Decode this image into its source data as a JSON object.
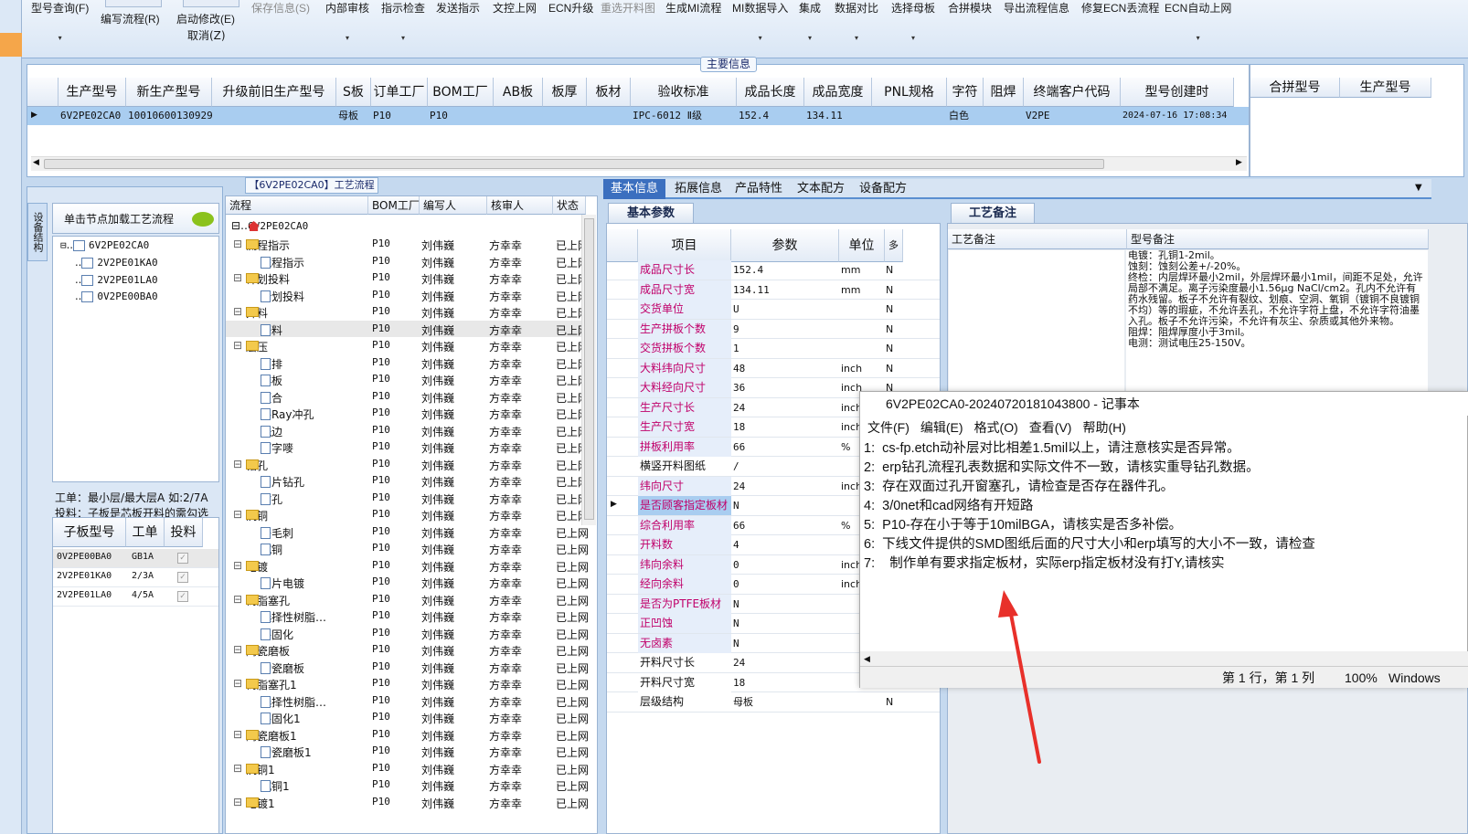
{
  "toolbar": {
    "items": [
      {
        "label": "型号查询(F)",
        "disabled": false
      },
      {
        "label": "编写流程(R)",
        "disabled": false
      },
      {
        "label": "启动修改(E)",
        "disabled": false
      },
      {
        "label": "保存信息(S)",
        "disabled": true
      },
      {
        "label": "内部审核",
        "disabled": false
      },
      {
        "label": "指示检查",
        "disabled": false
      },
      {
        "label": "发送指示",
        "disabled": false
      },
      {
        "label": "文控上网",
        "disabled": false
      },
      {
        "label": "ECN升级",
        "disabled": false
      },
      {
        "label": "重选开料图",
        "disabled": true
      },
      {
        "label": "生成MI流程",
        "disabled": false
      },
      {
        "label": "MI数据导入",
        "disabled": false
      },
      {
        "label": "集成",
        "disabled": false
      },
      {
        "label": "数据对比",
        "disabled": false
      },
      {
        "label": "选择母板",
        "disabled": false
      },
      {
        "label": "合拼模块",
        "disabled": false
      },
      {
        "label": "导出流程信息",
        "disabled": false
      },
      {
        "label": "修复ECN丢流程",
        "disabled": false
      },
      {
        "label": "ECN自动上网",
        "disabled": false
      }
    ],
    "cancel_label": "取消(Z)"
  },
  "main_info": {
    "title": "主要信息",
    "columns": [
      "生产型号",
      "新生产型号",
      "升级前旧生产型号",
      "S板",
      "订单工厂",
      "BOM工厂",
      "AB板",
      "板厚",
      "板材",
      "验收标准",
      "成品长度",
      "成品宽度",
      "PNL规格",
      "字符",
      "阻焊",
      "终端客户代码",
      "型号创建时"
    ],
    "row": [
      "6V2PE02CA0",
      "10010600130929",
      "",
      "母板",
      "P10",
      "P10",
      "",
      "",
      "",
      "IPC-6012 Ⅱ级",
      "152.4",
      "134.11",
      "",
      "白色",
      "",
      "V2PE",
      "2024-07-16 17:08:34"
    ],
    "merge_columns": [
      "合拼型号",
      "生产型号"
    ]
  },
  "left_panel": {
    "vertical_tab": "设备结构",
    "node_header": "单击节点加载工艺流程",
    "tree_root": "6V2PE02CA0",
    "tree_children": [
      "2V2PE01KA0",
      "2V2PE01LA0",
      "0V2PE00BA0"
    ],
    "work_note_1": "工单：最小层/最大层A 如:2/7A",
    "work_note_2": "投料：子板是芯板开料的需勾选",
    "sub_columns": [
      "子板型号",
      "工单",
      "投料"
    ],
    "sub_rows": [
      {
        "model": "0V2PE00BA0",
        "order": "GB1A"
      },
      {
        "model": "2V2PE01KA0",
        "order": "2/3A"
      },
      {
        "model": "2V2PE01LA0",
        "order": "4/5A"
      }
    ]
  },
  "process": {
    "title": "【6V2PE02CA0】工艺流程",
    "columns": [
      "流程",
      "BOM工厂",
      "编写人",
      "核审人",
      "状态"
    ],
    "root": "6V2PE02CA0",
    "rows": [
      {
        "name": "流程指示",
        "type": "folder",
        "bom": "P10",
        "writer": "刘伟巍",
        "reviewer": "方幸幸",
        "status": "已上网"
      },
      {
        "name": "流程指示",
        "type": "doc",
        "bom": "P10",
        "writer": "刘伟巍",
        "reviewer": "方幸幸",
        "status": "已上网"
      },
      {
        "name": "计划投料",
        "type": "folder",
        "bom": "P10",
        "writer": "刘伟巍",
        "reviewer": "方幸幸",
        "status": "已上网"
      },
      {
        "name": "计划投料",
        "type": "doc",
        "bom": "P10",
        "writer": "刘伟巍",
        "reviewer": "方幸幸",
        "status": "已上网"
      },
      {
        "name": "开料",
        "type": "folder",
        "bom": "P10",
        "writer": "刘伟巍",
        "reviewer": "方幸幸",
        "status": "已上网"
      },
      {
        "name": "开料",
        "type": "doc",
        "bom": "P10",
        "writer": "刘伟巍",
        "reviewer": "方幸幸",
        "status": "已上网",
        "selected": true
      },
      {
        "name": "层压",
        "type": "folder",
        "bom": "P10",
        "writer": "刘伟巍",
        "reviewer": "方幸幸",
        "status": "已上网"
      },
      {
        "name": "预排",
        "type": "doc",
        "bom": "P10",
        "writer": "刘伟巍",
        "reviewer": "方幸幸",
        "status": "已上网"
      },
      {
        "name": "排板",
        "type": "doc",
        "bom": "P10",
        "writer": "刘伟巍",
        "reviewer": "方幸幸",
        "status": "已上网"
      },
      {
        "name": "压合",
        "type": "doc",
        "bom": "P10",
        "writer": "刘伟巍",
        "reviewer": "方幸幸",
        "status": "已上网"
      },
      {
        "name": "X-Ray冲孔",
        "type": "doc",
        "bom": "P10",
        "writer": "刘伟巍",
        "reviewer": "方幸幸",
        "status": "已上网"
      },
      {
        "name": "铣边",
        "type": "doc",
        "bom": "P10",
        "writer": "刘伟巍",
        "reviewer": "方幸幸",
        "status": "已上网"
      },
      {
        "name": "打字嘜",
        "type": "doc",
        "bom": "P10",
        "writer": "刘伟巍",
        "reviewer": "方幸幸",
        "status": "已上网"
      },
      {
        "name": "钻孔",
        "type": "folder",
        "bom": "P10",
        "writer": "刘伟巍",
        "reviewer": "方幸幸",
        "status": "已上网"
      },
      {
        "name": "铝片钻孔",
        "type": "doc",
        "bom": "P10",
        "writer": "刘伟巍",
        "reviewer": "方幸幸",
        "status": "已上网"
      },
      {
        "name": "钻孔",
        "type": "doc",
        "bom": "P10",
        "writer": "刘伟巍",
        "reviewer": "方幸幸",
        "status": "已上网"
      },
      {
        "name": "沉铜",
        "type": "folder",
        "bom": "P10",
        "writer": "刘伟巍",
        "reviewer": "方幸幸",
        "status": "已上网"
      },
      {
        "name": "去毛刺",
        "type": "doc",
        "bom": "P10",
        "writer": "刘伟巍",
        "reviewer": "方幸幸",
        "status": "已上网"
      },
      {
        "name": "沉铜",
        "type": "doc",
        "bom": "P10",
        "writer": "刘伟巍",
        "reviewer": "方幸幸",
        "status": "已上网"
      },
      {
        "name": "电镀",
        "type": "folder",
        "bom": "P10",
        "writer": "刘伟巍",
        "reviewer": "方幸幸",
        "status": "已上网"
      },
      {
        "name": "负片电镀",
        "type": "doc",
        "bom": "P10",
        "writer": "刘伟巍",
        "reviewer": "方幸幸",
        "status": "已上网"
      },
      {
        "name": "树脂塞孔",
        "type": "folder",
        "bom": "P10",
        "writer": "刘伟巍",
        "reviewer": "方幸幸",
        "status": "已上网"
      },
      {
        "name": "选择性树脂…",
        "type": "doc",
        "bom": "P10",
        "writer": "刘伟巍",
        "reviewer": "方幸幸",
        "status": "已上网"
      },
      {
        "name": "终固化",
        "type": "doc",
        "bom": "P10",
        "writer": "刘伟巍",
        "reviewer": "方幸幸",
        "status": "已上网"
      },
      {
        "name": "陶瓷磨板",
        "type": "folder",
        "bom": "P10",
        "writer": "刘伟巍",
        "reviewer": "方幸幸",
        "status": "已上网"
      },
      {
        "name": "陶瓷磨板",
        "type": "doc",
        "bom": "P10",
        "writer": "刘伟巍",
        "reviewer": "方幸幸",
        "status": "已上网"
      },
      {
        "name": "树脂塞孔1",
        "type": "folder",
        "bom": "P10",
        "writer": "刘伟巍",
        "reviewer": "方幸幸",
        "status": "已上网"
      },
      {
        "name": "选择性树脂…",
        "type": "doc",
        "bom": "P10",
        "writer": "刘伟巍",
        "reviewer": "方幸幸",
        "status": "已上网"
      },
      {
        "name": "终固化1",
        "type": "doc",
        "bom": "P10",
        "writer": "刘伟巍",
        "reviewer": "方幸幸",
        "status": "已上网"
      },
      {
        "name": "陶瓷磨板1",
        "type": "folder",
        "bom": "P10",
        "writer": "刘伟巍",
        "reviewer": "方幸幸",
        "status": "已上网"
      },
      {
        "name": "陶瓷磨板1",
        "type": "doc",
        "bom": "P10",
        "writer": "刘伟巍",
        "reviewer": "方幸幸",
        "status": "已上网"
      },
      {
        "name": "沉铜1",
        "type": "folder",
        "bom": "P10",
        "writer": "刘伟巍",
        "reviewer": "方幸幸",
        "status": "已上网"
      },
      {
        "name": "沉铜1",
        "type": "doc",
        "bom": "P10",
        "writer": "刘伟巍",
        "reviewer": "方幸幸",
        "status": "已上网"
      },
      {
        "name": "电镀1",
        "type": "folder",
        "bom": "P10",
        "writer": "刘伟巍",
        "reviewer": "方幸幸",
        "status": "已上网"
      }
    ]
  },
  "tabs": {
    "items": [
      "基本信息",
      "拓展信息",
      "产品特性",
      "文本配方",
      "设备配方"
    ],
    "active": 0
  },
  "basic_params": {
    "title": "基本参数",
    "columns": [
      "项目",
      "参数",
      "单位",
      "多"
    ],
    "rows": [
      {
        "name": "成品尺寸长",
        "value": "152.4",
        "unit": "mm",
        "flag": "N",
        "pink": true
      },
      {
        "name": "成品尺寸宽",
        "value": "134.11",
        "unit": "mm",
        "flag": "N",
        "pink": true
      },
      {
        "name": "交货单位",
        "value": "U",
        "unit": "",
        "flag": "N",
        "pink": true
      },
      {
        "name": "生产拼板个数",
        "value": "9",
        "unit": "",
        "flag": "N",
        "pink": true
      },
      {
        "name": "交货拼板个数",
        "value": "1",
        "unit": "",
        "flag": "N",
        "pink": true
      },
      {
        "name": "大料纬向尺寸",
        "value": "48",
        "unit": "inch",
        "flag": "N",
        "pink": true
      },
      {
        "name": "大料经向尺寸",
        "value": "36",
        "unit": "inch",
        "flag": "N",
        "pink": true
      },
      {
        "name": "生产尺寸长",
        "value": "24",
        "unit": "inch",
        "flag": "",
        "pink": true
      },
      {
        "name": "生产尺寸宽",
        "value": "18",
        "unit": "inch",
        "flag": "",
        "pink": true
      },
      {
        "name": "拼板利用率",
        "value": "66",
        "unit": "%",
        "flag": "",
        "pink": true
      },
      {
        "name": "横竖开料图纸",
        "value": "/",
        "unit": "",
        "flag": "",
        "pink": false
      },
      {
        "name": "纬向尺寸",
        "value": "24",
        "unit": "inch",
        "flag": "",
        "pink": true
      },
      {
        "name": "是否顾客指定板材",
        "value": "N",
        "unit": "",
        "flag": "",
        "pink": true,
        "selected": true
      },
      {
        "name": "综合利用率",
        "value": "66",
        "unit": "%",
        "flag": "",
        "pink": true
      },
      {
        "name": "开料数",
        "value": "4",
        "unit": "",
        "flag": "",
        "pink": true
      },
      {
        "name": "纬向余料",
        "value": "0",
        "unit": "inch",
        "flag": "",
        "pink": true
      },
      {
        "name": "经向余料",
        "value": "0",
        "unit": "inch",
        "flag": "",
        "pink": true
      },
      {
        "name": "是否为PTFE板材",
        "value": "N",
        "unit": "",
        "flag": "",
        "pink": true
      },
      {
        "name": "正凹蚀",
        "value": "N",
        "unit": "",
        "flag": "",
        "pink": true
      },
      {
        "name": "无卤素",
        "value": "N",
        "unit": "",
        "flag": "",
        "pink": true
      },
      {
        "name": "开料尺寸长",
        "value": "24",
        "unit": "",
        "flag": "",
        "pink": false
      },
      {
        "name": "开料尺寸宽",
        "value": "18",
        "unit": "",
        "flag": "",
        "pink": false
      },
      {
        "name": "层级结构",
        "value": "母板",
        "unit": "",
        "flag": "N",
        "pink": false
      }
    ]
  },
  "craft": {
    "title": "工艺备注",
    "col1": "工艺备注",
    "col2": "型号备注",
    "notes": "电镀：孔铜1-2mil。\n蚀刻：蚀刻公差+/-20%。\n终检：内层焊环最小2mil，外层焊环最小1mil，间距不足处，允许局部不满足。离子污染度最小1.56μg NaCl/cm2。孔内不允许有药水残留。板子不允许有裂纹、划痕、空洞、氧铜（镀铜不良镀铜不均）等的瑕疵，不允许丢孔，不允许字符上盘，不允许字符油墨入孔。板子不允许污染，不允许有灰尘、杂质或其他外来物。\n阻焊：阻焊厚度小于3mil。\n电测：测试电压25-150V。"
  },
  "notepad": {
    "title": "6V2PE02CA0-20240720181043800 - 记事本",
    "menu": [
      "文件(F)",
      "编辑(E)",
      "格式(O)",
      "查看(V)",
      "帮助(H)"
    ],
    "lines": [
      "1:  cs-fp.etch动补层对比相差1.5mil以上，请注意核实是否异常。",
      "2:  erp钻孔流程孔表数据和实际文件不一致，请核实重导钻孔数据。",
      "3:  存在双面过孔开窗塞孔，请检查是否存在器件孔。",
      "4:  3/0net和cad网络有开短路",
      "5:  P10-存在小于等于10milBGA，请核实是否多补偿。",
      "6:  下线文件提供的SMD图纸后面的尺寸大小和erp填写的大小不一致，请检查",
      "7:    制作单有要求指定板材，实际erp指定板材没有打Y,请核实"
    ],
    "status_pos": "第 1 行，第 1 列",
    "status_zoom": "100%",
    "status_eol": "Windows"
  },
  "colors": {
    "annotation_arrow": "#e8302a",
    "selection": "#a9cdf0",
    "tab_active": "#3b6fbf",
    "param_name": "#c0006a"
  }
}
